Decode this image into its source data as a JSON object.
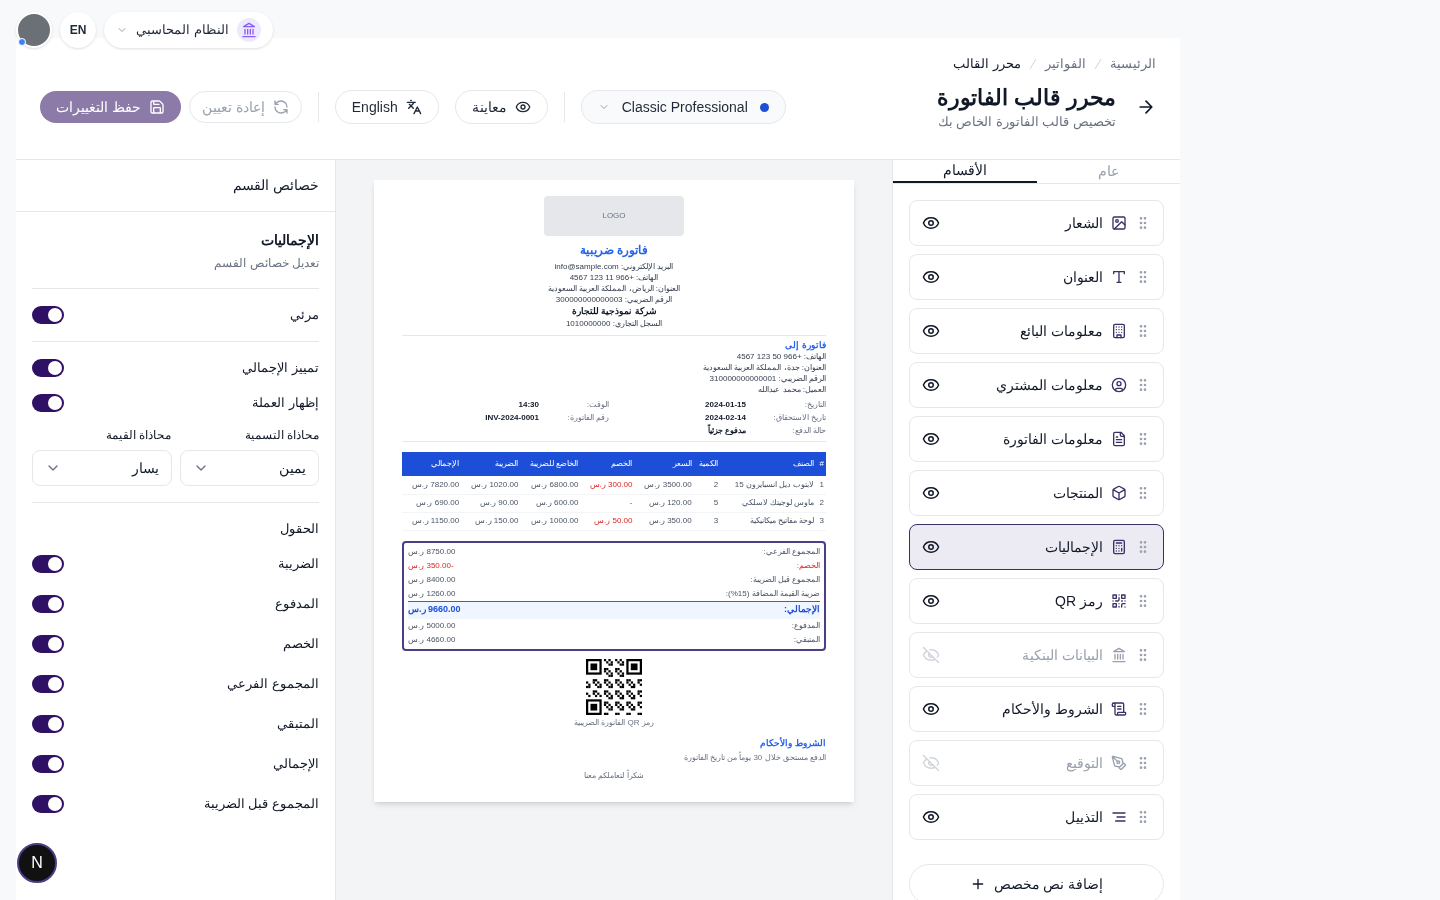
{
  "top_bar": {
    "language": "EN",
    "system": "النظام المحاسبي"
  },
  "breadcrumb": [
    {
      "label": "الرئيسية",
      "current": false
    },
    {
      "label": "الفواتير",
      "current": false
    },
    {
      "label": "محرر القالب",
      "current": true
    }
  ],
  "page": {
    "title": "محرر قالب الفاتورة",
    "subtitle": "تخصيص قالب الفاتورة الخاص بك"
  },
  "toolbar": {
    "template": "Classic Professional",
    "preview": "معاينة",
    "language": "English",
    "reset": {
      "label": "إعادة تعيين",
      "disabled": true
    },
    "save": {
      "label": "حفظ التغييرات",
      "disabled": true
    }
  },
  "tabs": [
    {
      "label": "عام",
      "selected": false
    },
    {
      "label": "الأقسام",
      "selected": true
    }
  ],
  "sections": [
    {
      "label": "الشعار",
      "visible": true,
      "selected": false
    },
    {
      "label": "العنوان",
      "visible": true,
      "selected": false
    },
    {
      "label": "معلومات البائع",
      "visible": true,
      "selected": false
    },
    {
      "label": "معلومات المشتري",
      "visible": true,
      "selected": false
    },
    {
      "label": "معلومات الفاتورة",
      "visible": true,
      "selected": false
    },
    {
      "label": "المنتجات",
      "visible": true,
      "selected": false
    },
    {
      "label": "الإجماليات",
      "visible": true,
      "selected": true
    },
    {
      "label": "رمز QR",
      "visible": true,
      "selected": false
    },
    {
      "label": "البيانات البنكية",
      "visible": false,
      "selected": false
    },
    {
      "label": "الشروط والأحكام",
      "visible": true,
      "selected": false
    },
    {
      "label": "التوقيع",
      "visible": false,
      "selected": false
    },
    {
      "label": "التذييل",
      "visible": true,
      "selected": false
    }
  ],
  "add_button": "إضافة نص مخصص",
  "invoice_preview": {
    "logo": "LOGO",
    "title": "فاتورة ضريبية",
    "seller_lines": [
      "البريد الإلكتروني: info@sample.com",
      "الهاتف: +966 11 123 4567",
      "العنوان: الرياض، المملكة العربية السعودية",
      "الرقم الضريبي: 300000000000003"
    ],
    "company": "شركة نموذجية للتجارة",
    "registration": "السجل التجاري: 1010000000",
    "bill_to": {
      "heading": "فاتورة إلى",
      "lines": [
        "الهاتف: +966 50 123 4567",
        "العنوان: جدة، المملكة العربية السعودية",
        "الرقم الضريبي: 310000000000001",
        "العميل: محمد عبدالله"
      ]
    },
    "meta": [
      {
        "label": "التاريخ:",
        "value": "2024-01-15"
      },
      {
        "label": "الوقت:",
        "value": "14:30"
      },
      {
        "label": "تاريخ الاستحقاق:",
        "value": "2024-02-14"
      },
      {
        "label": "رقم الفاتورة:",
        "value": "INV-2024-0001"
      },
      {
        "label": "حالة الدفع:",
        "value": "مدفوع جزئياً"
      }
    ],
    "table": {
      "columns": [
        "#",
        "الصنف",
        "الكمية",
        "السعر",
        "الخصم",
        "الخاضع للضريبة",
        "الضريبة",
        "الإجمالي"
      ],
      "rows": [
        [
          "1",
          "لابتوب ديل انسبايرون 15",
          "2",
          "3500.00 ر.س",
          "300.00 ر.س",
          "6800.00 ر.س",
          "1020.00 ر.س",
          "7820.00 ر.س"
        ],
        [
          "2",
          "ماوس لوجيتك لاسلكي",
          "5",
          "120.00 ر.س",
          "-",
          "600.00 ر.س",
          "90.00 ر.س",
          "690.00 ر.س"
        ],
        [
          "3",
          "لوحة مفاتيح ميكانيكية",
          "3",
          "350.00 ر.س",
          "50.00 ر.س",
          "1000.00 ر.س",
          "150.00 ر.س",
          "1150.00 ر.س"
        ]
      ]
    },
    "totals": [
      {
        "label": "المجموع الفرعي:",
        "value": "8750.00 ر.س",
        "kind": "normal"
      },
      {
        "label": "الخصم:",
        "value": "-350.00 ر.س",
        "kind": "discount"
      },
      {
        "label": "المجموع قبل الضريبة:",
        "value": "8400.00 ر.س",
        "kind": "normal"
      },
      {
        "label": "ضريبة القيمة المضافة (15%):",
        "value": "1260.00 ر.س",
        "kind": "normal"
      },
      {
        "label": "الإجمالي:",
        "value": "9660.00 ر.س",
        "kind": "grand"
      },
      {
        "label": "المدفوع:",
        "value": "5000.00 ر.س",
        "kind": "normal"
      },
      {
        "label": "المتبقي:",
        "value": "4660.00 ر.س",
        "kind": "normal"
      }
    ],
    "qr_caption": "رمز QR الفاتورة الضريبية",
    "terms_heading": "الشروط والأحكام",
    "terms": "الدفع مستحق خلال 30 يوماً من تاريخ الفاتورة",
    "footer": "شكراً لتعاملكم معنا"
  },
  "properties": {
    "header": "خصائص القسم",
    "title": "الإجماليات",
    "subtitle": "تعديل خصائص القسم",
    "visible": {
      "label": "مرئي",
      "on": true
    },
    "options": [
      {
        "label": "تمييز الإجمالي",
        "on": true
      },
      {
        "label": "إظهار العملة",
        "on": true
      }
    ],
    "alignments": [
      {
        "label": "محاذاة التسمية",
        "value": "يمين"
      },
      {
        "label": "محاذاة القيمة",
        "value": "يسار"
      }
    ],
    "fields_heading": "الحقول",
    "fields": [
      {
        "label": "الضريبة",
        "on": true
      },
      {
        "label": "المدفوع",
        "on": true
      },
      {
        "label": "الخصم",
        "on": true
      },
      {
        "label": "المجموع الفرعي",
        "on": true
      },
      {
        "label": "المتبقي",
        "on": true
      },
      {
        "label": "الإجمالي",
        "on": true
      },
      {
        "label": "المجموع قبل الضريبة",
        "on": true
      }
    ]
  },
  "dev_badge": "N"
}
